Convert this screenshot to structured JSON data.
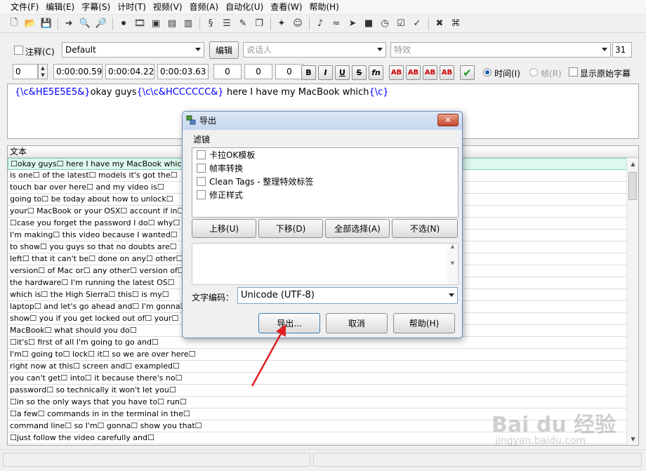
{
  "menu": [
    "文件(F)",
    "编辑(E)",
    "字幕(S)",
    "计时(T)",
    "视频(V)",
    "音频(A)",
    "自动化(U)",
    "查看(W)",
    "帮助(H)"
  ],
  "toolbar_icons": [
    "new-file-icon",
    "open-folder-icon",
    "save-icon",
    "arrow-icon",
    "zoom-in-icon",
    "zoom-out-icon",
    "record-icon",
    "film-icon",
    "video-icon",
    "film-strip-icon",
    "film-alt-icon",
    "script-icon",
    "notes-icon",
    "pencil-icon",
    "copy-icon",
    "puzzle-icon",
    "face-icon",
    "audio-icon",
    "wave-icon",
    "fish-icon",
    "stop-icon",
    "clock-icon",
    "check-chart-icon",
    "check-icon",
    "tools-icon",
    "tag-icon"
  ],
  "editor": {
    "comment_label": "注释(C)",
    "style_value": "Default",
    "edit_button": "编辑",
    "actor_placeholder": "说话人",
    "effect_placeholder": "特效",
    "layer_value": "31",
    "line_index": "0",
    "start_time": "0:00:00.59",
    "end_time": "0:00:04.22",
    "duration": "0:00:03.63",
    "margin_l": "0",
    "margin_r": "0",
    "margin_v": "0",
    "format_buttons": [
      "B",
      "I",
      "U",
      "S",
      "fn"
    ],
    "color_buttons": [
      "AB",
      "AB",
      "AB",
      "AB"
    ],
    "time_mode_label": "时间(I)",
    "frame_mode_label": "帧(R)",
    "show_original_label": "显示原始字幕",
    "text_parts": [
      {
        "t": "{\\c&HE5E5E5&}",
        "kind": "tag"
      },
      {
        "t": "okay guys",
        "kind": "plain"
      },
      {
        "t": "{\\c\\c&HCCCCCC&}",
        "kind": "tag"
      },
      {
        "t": " here I have my MacBook which",
        "kind": "plain"
      },
      {
        "t": "{\\c}",
        "kind": "tag"
      }
    ]
  },
  "grid": {
    "header": "文本",
    "rows": [
      "☐okay guys☐ here I have my MacBook which☐",
      "is one☐ of the latest☐ models it's got the☐",
      "touch bar over here☐ and my video is☐",
      "going to☐ be today about how to unlock☐",
      "your☐ MacBook or your OSX☐ account if in☐",
      "☐case you forget the password I do☐ why☐",
      "I'm making☐ this video because I wanted☐",
      "to show☐ you guys so that no doubts are☐",
      "left☐ that it can't be☐ done on any☐ other☐",
      "version☐ of Mac or☐ any other☐ version of☐",
      "the hardware☐ I'm running the latest OS☐",
      "which is☐ the High Sierra☐ this☐ is my☐",
      "laptop☐ and let's go ahead and☐ I'm gonna☐",
      "show☐ you if you get locked out of☐ your☐",
      "MacBook☐ what should you do☐",
      "☐it's☐ first of all I'm going to go and☐",
      "I'm☐ going to☐ lock☐ it☐ so we are over here☐",
      "right now at this☐ screen and☐ exampled☐",
      "you can't get☐ into☐ it because there's no☐",
      "password☐ so technically it won't let you☐",
      "☐in so the only ways that you have to☐ run☐",
      "☐a few☐ commands in in the terminal in the☐",
      "command line☐ so I'm☐ gonna☐ show you that☐",
      "☐just follow the video carefully and☐"
    ]
  },
  "dialog": {
    "title": "导出",
    "filter_label": "滤镜",
    "filters": [
      "卡拉OK模板",
      "帧率转换",
      "Clean Tags - 整理特效标签",
      "修正样式"
    ],
    "move_up": "上移(U)",
    "move_down": "下移(D)",
    "select_all": "全部选择(A)",
    "select_none": "不选(N)",
    "encoding_label": "文字编码：",
    "encoding_value": "Unicode (UTF-8)",
    "export_button": "导出...",
    "cancel_button": "取消",
    "help_button": "帮助(H)",
    "close_glyph": "✕"
  },
  "watermark": {
    "main": "Bai du 经验",
    "sub": "jingyan.baidu.com"
  }
}
